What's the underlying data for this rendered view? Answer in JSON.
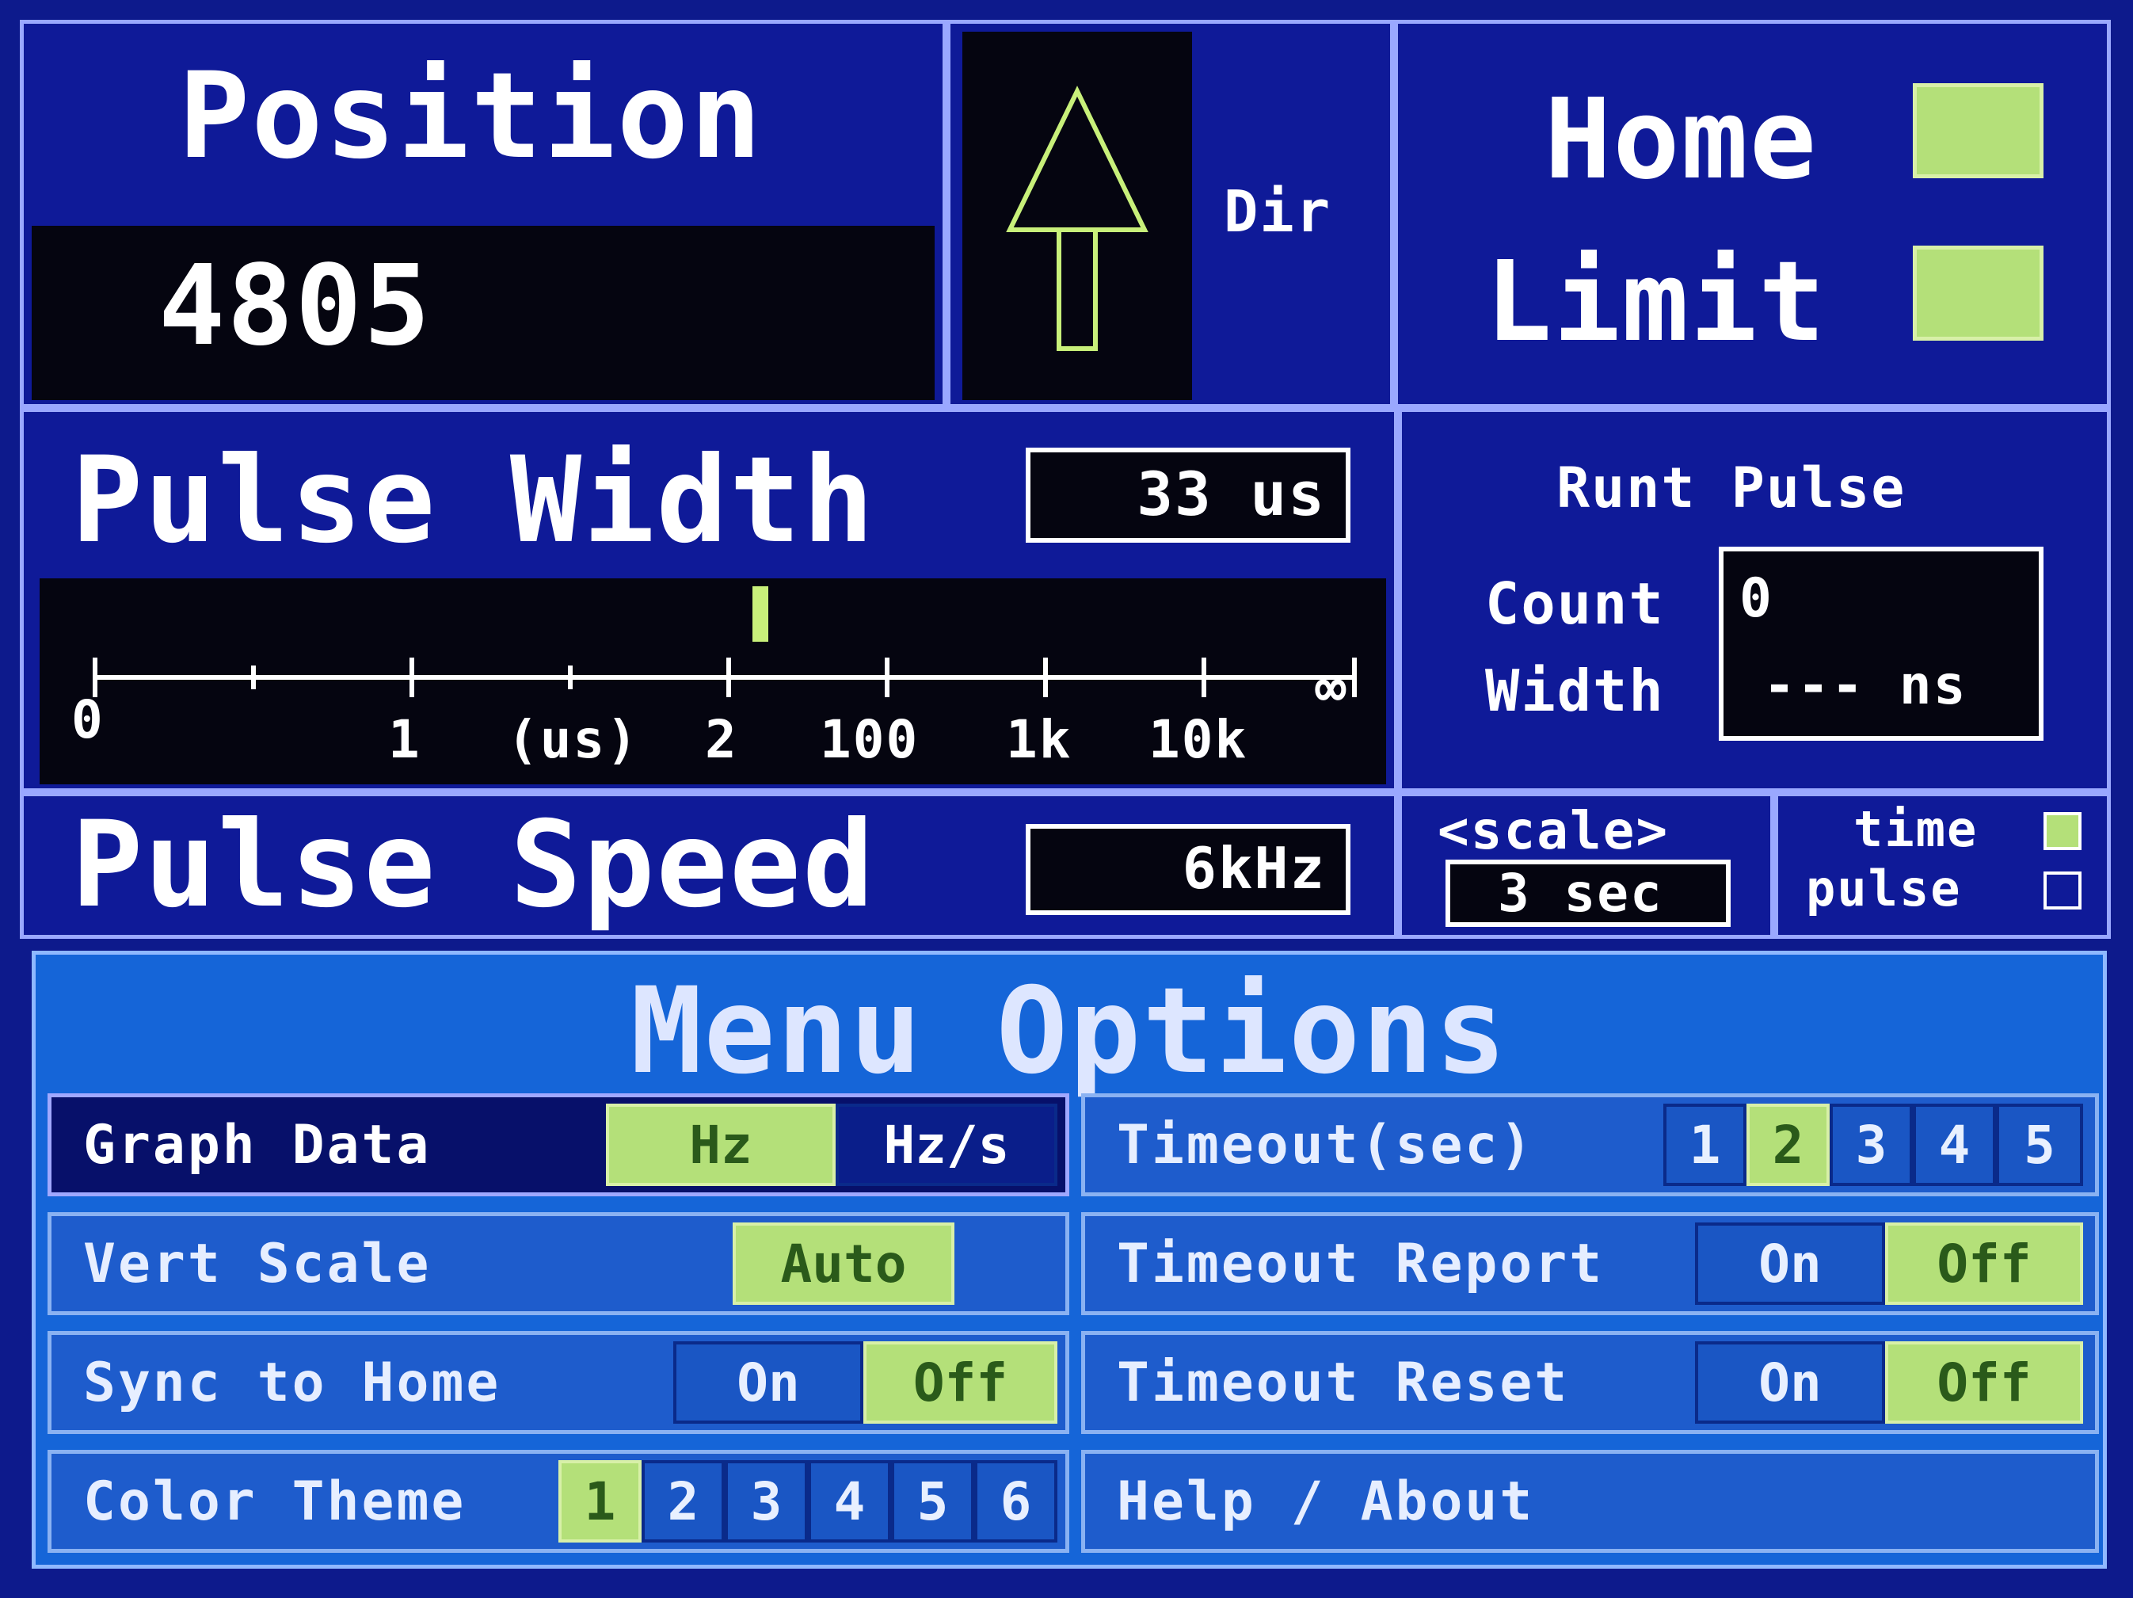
{
  "position": {
    "title": "Position",
    "value": "4805"
  },
  "direction": {
    "label": "Dir",
    "arrow": "up-arrow"
  },
  "status": {
    "home_label": "Home",
    "limit_label": "Limit",
    "indicator_color": "#b4e079"
  },
  "pulse_width": {
    "title": "Pulse Width",
    "value": "33 us",
    "scale_labels": [
      "0",
      "1",
      "(us)",
      "2",
      "100",
      "1k",
      "10k",
      "∞"
    ],
    "marker_fraction": 0.5
  },
  "runt_pulse": {
    "title": "Runt Pulse",
    "count_label": "Count",
    "width_label": "Width",
    "count_value": "0",
    "width_value": "--- ns"
  },
  "pulse_speed": {
    "title": "Pulse Speed",
    "value": "6kHz"
  },
  "scale": {
    "label": "<scale>",
    "value": "3 sec"
  },
  "mode": {
    "time_label": "time",
    "pulse_label": "pulse"
  },
  "menu": {
    "title": "Menu Options",
    "graph_data": {
      "label": "Graph Data",
      "options": [
        "Hz",
        "Hz/s"
      ]
    },
    "vert_scale": {
      "label": "Vert Scale",
      "option": "Auto"
    },
    "sync_home": {
      "label": "Sync to Home",
      "options": [
        "On",
        "Off"
      ]
    },
    "color_theme": {
      "label": "Color Theme",
      "options": [
        "1",
        "2",
        "3",
        "4",
        "5",
        "6"
      ]
    },
    "timeout": {
      "label": "Timeout(sec)",
      "options": [
        "1",
        "2",
        "3",
        "4",
        "5"
      ]
    },
    "timeout_report": {
      "label": "Timeout Report",
      "options": [
        "On",
        "Off"
      ]
    },
    "timeout_reset": {
      "label": "Timeout Reset",
      "options": [
        "On",
        "Off"
      ]
    },
    "help": {
      "label": "Help / About"
    }
  }
}
